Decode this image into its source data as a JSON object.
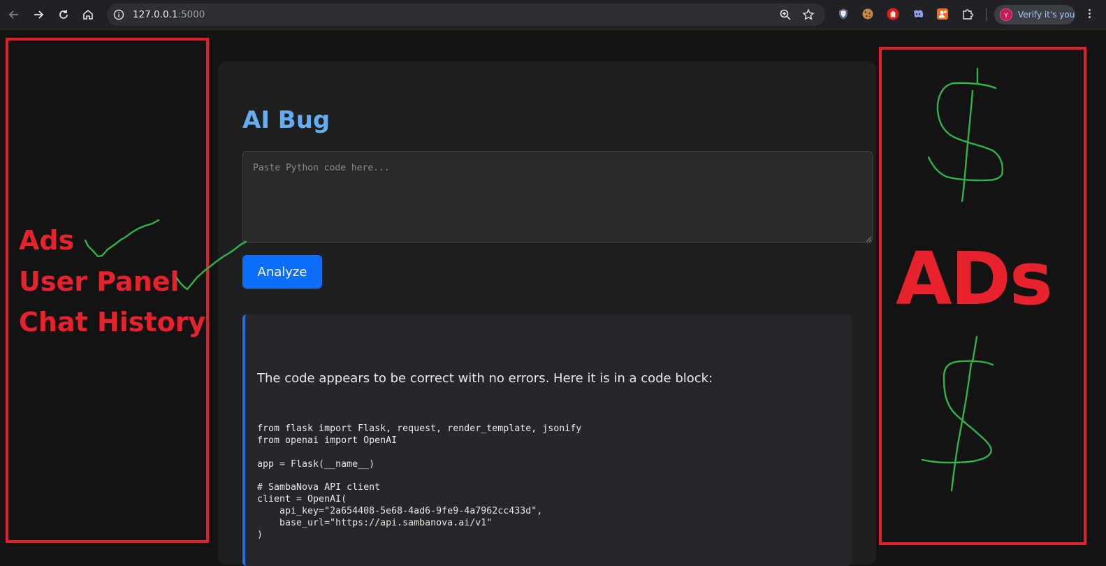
{
  "browser": {
    "url_host": "127.0.0.1",
    "url_port": ":5000",
    "profile_initial": "Y",
    "profile_label": "Verify it's you",
    "icons": [
      "back-arrow-icon",
      "forward-arrow-icon",
      "reload-icon",
      "home-icon",
      "site-info-icon",
      "zoom-icon",
      "bookmark-star-icon",
      "shield-extension-icon",
      "cookie-extension-icon",
      "stop-hand-extension-icon",
      "discord-extension-icon",
      "person-extension-icon",
      "puzzle-extensions-icon",
      "more-menu-icon"
    ]
  },
  "annotations": {
    "left_lines": [
      "Ads",
      "User Panel",
      "Chat History"
    ],
    "right_big": "ADs",
    "colors": {
      "box": "#e0202a",
      "scribble": "#2fb34a"
    }
  },
  "app": {
    "title": "AI Bug",
    "input_placeholder": "Paste Python code here...",
    "analyze_label": "Analyze",
    "result_text": "The code appears to be correct with no errors. Here it is in a code block:",
    "code_lines": [
      "from flask import Flask, request, render_template, jsonify",
      "from openai import OpenAI",
      "",
      "app = Flask(__name__)",
      "",
      "# SambaNova API client",
      "client = OpenAI(",
      "    api_key=\"2a654408-5e68-4ad6-9fe9-4a7962cc433d\",",
      "    base_url=\"https://api.sambanova.ai/v1\"",
      ")"
    ],
    "colors": {
      "title": "#64adf2",
      "button": "#0d6efd",
      "result_border": "#1f6feb"
    }
  }
}
